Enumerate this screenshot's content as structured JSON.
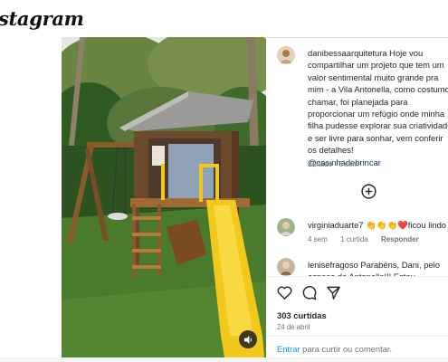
{
  "brand": {
    "logo_text": "Instagram",
    "visible_logo": "stagram"
  },
  "post": {
    "author": "danibessaarquitetura",
    "caption": "Hoje vou compartilhar um projeto que tem um valor sentimental muito grande pra mim - a Vila Antonella, como costumo chamar, foi planejada para proporcionar um refúgio onde minha filha pudesse explorar sua criatividade e ser livre para sonhar, vem conferir os detalhes!",
    "mention": "@casinhadebrincar",
    "edited": "Editado · 6 sem",
    "likes": "303 curtidas",
    "date": "24 de abril"
  },
  "comments": [
    {
      "user": "virginiaduarte7",
      "text": "👏👏👏❤️ficou lindo",
      "age": "4 sem",
      "likes": "1 curtida",
      "reply": "Responder"
    },
    {
      "user": "lenisefragoso",
      "text": "Parabéns, Dani, pelo espaço da Antonella!!! Estou",
      "age": "",
      "likes": "",
      "reply": ""
    }
  ],
  "composer": {
    "link": "Entrar",
    "text": " para curtir ou comentar."
  },
  "icons": {
    "sound": "volume-icon",
    "load_more": "plus-circle-icon",
    "like": "heart-icon",
    "comment": "comment-icon",
    "share": "share-icon"
  },
  "colors": {
    "link": "#00376b",
    "action_link": "#0095f6",
    "slide": "#f2c81c",
    "grass": "#4a7a2b"
  }
}
